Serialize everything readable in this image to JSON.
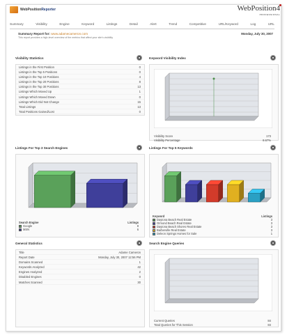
{
  "header": {
    "brand_prefix": "WebPosition",
    "brand_suffix": "Reporter",
    "product": "WebPosition4",
    "product_tagline": "PROFESSIONAL"
  },
  "nav": [
    "Summary",
    "Visibility",
    "Engine",
    "Keyword",
    "Listings",
    "Detail",
    "Alert",
    "Trend",
    "Competitive",
    "URL/Keyword",
    "Log",
    "URL"
  ],
  "summary": {
    "title": "Summary Report for:",
    "site": "www.adamecameron.com",
    "description": "This report provides a high-level overview of the metrics that affect your site's visibility",
    "date": "Monday, July 30, 2007"
  },
  "visibility_stats": {
    "title": "Visibility Statistics",
    "rows": [
      {
        "label": "Listings in the First Position",
        "value": "0"
      },
      {
        "label": "Listings in the Top 5 Positions",
        "value": "0"
      },
      {
        "label": "Listings in the Top 10 Positions",
        "value": "4"
      },
      {
        "label": "Listings in the Top 20 Positions",
        "value": "8"
      },
      {
        "label": "Listings in the Top 30 Positions",
        "value": "13"
      },
      {
        "label": "Listings Which Moved Up",
        "value": "1"
      },
      {
        "label": "Listings Which Moved Down",
        "value": "0"
      },
      {
        "label": "Listings Which Did Not Change",
        "value": "15"
      },
      {
        "label": "Total Listings",
        "value": "13"
      },
      {
        "label": "Total Positions Gained/Lost",
        "value": "0"
      }
    ]
  },
  "keyword_visibility": {
    "title": "Keyword Visibility Index",
    "score_label": "Visibility Score",
    "score_value": "173",
    "pct_label": "Visibility Percentage",
    "pct_value": "8.67%"
  },
  "top3_engines": {
    "title": "Listings For Top 3 Search Engines",
    "col_engine": "Search Engine",
    "col_listings": "Listings",
    "items": [
      {
        "name": "Google",
        "value": "8",
        "color": "#5aa15a"
      },
      {
        "name": "MSN",
        "value": "6",
        "color": "#3f3f9a"
      }
    ]
  },
  "top5_keywords": {
    "title": "Listings For Top 5 Keywords",
    "col_keyword": "Keyword",
    "col_listings": "Listings",
    "items": [
      {
        "name": "Daytona Beach Real Estate",
        "value": "3",
        "color": "#5aa15a"
      },
      {
        "name": "Ormond Beach Real Estate",
        "value": "3",
        "color": "#3f3f9a"
      },
      {
        "name": "Daytona Beach Shores Real Estate",
        "value": "3",
        "color": "#d33b2a"
      },
      {
        "name": "Barberville Real Estate",
        "value": "3",
        "color": "#e0b020"
      },
      {
        "name": "Deleon Springs Homes for Sale",
        "value": "1",
        "color": "#2aa0c4"
      }
    ]
  },
  "general_stats": {
    "title": "General Statistics",
    "rows": [
      {
        "label": "Title",
        "value": "Adame Cameron"
      },
      {
        "label": "Report Date",
        "value": "Monday, July 30, 2007 12:56 PM"
      },
      {
        "label": "Domains Scanned",
        "value": "1"
      },
      {
        "label": "Keywords Analyzed",
        "value": "42"
      },
      {
        "label": "Engines Analyzed",
        "value": "2"
      },
      {
        "label": "Disabled Engines",
        "value": "0"
      },
      {
        "label": "Matches Scanned",
        "value": "30"
      }
    ]
  },
  "search_queries": {
    "title": "Search Engine Queries",
    "current_label": "Current Queries",
    "current_value": "84",
    "total_label": "Total Queries for This Session",
    "total_value": "84"
  },
  "chart_data": [
    {
      "type": "bar",
      "title": "Listings For Top 3 Search Engines",
      "categories": [
        "Google",
        "MSN"
      ],
      "values": [
        8,
        6
      ],
      "ylim": [
        0,
        10
      ]
    },
    {
      "type": "bar",
      "title": "Listings For Top 5 Keywords",
      "categories": [
        "Daytona Beach Real Estate",
        "Ormond Beach Real Estate",
        "Daytona Beach Shores Real Estate",
        "Barberville Real Estate",
        "Deleon Springs Homes for Sale"
      ],
      "values": [
        3,
        2,
        2,
        2,
        1
      ],
      "ylim": [
        0,
        4
      ]
    }
  ]
}
